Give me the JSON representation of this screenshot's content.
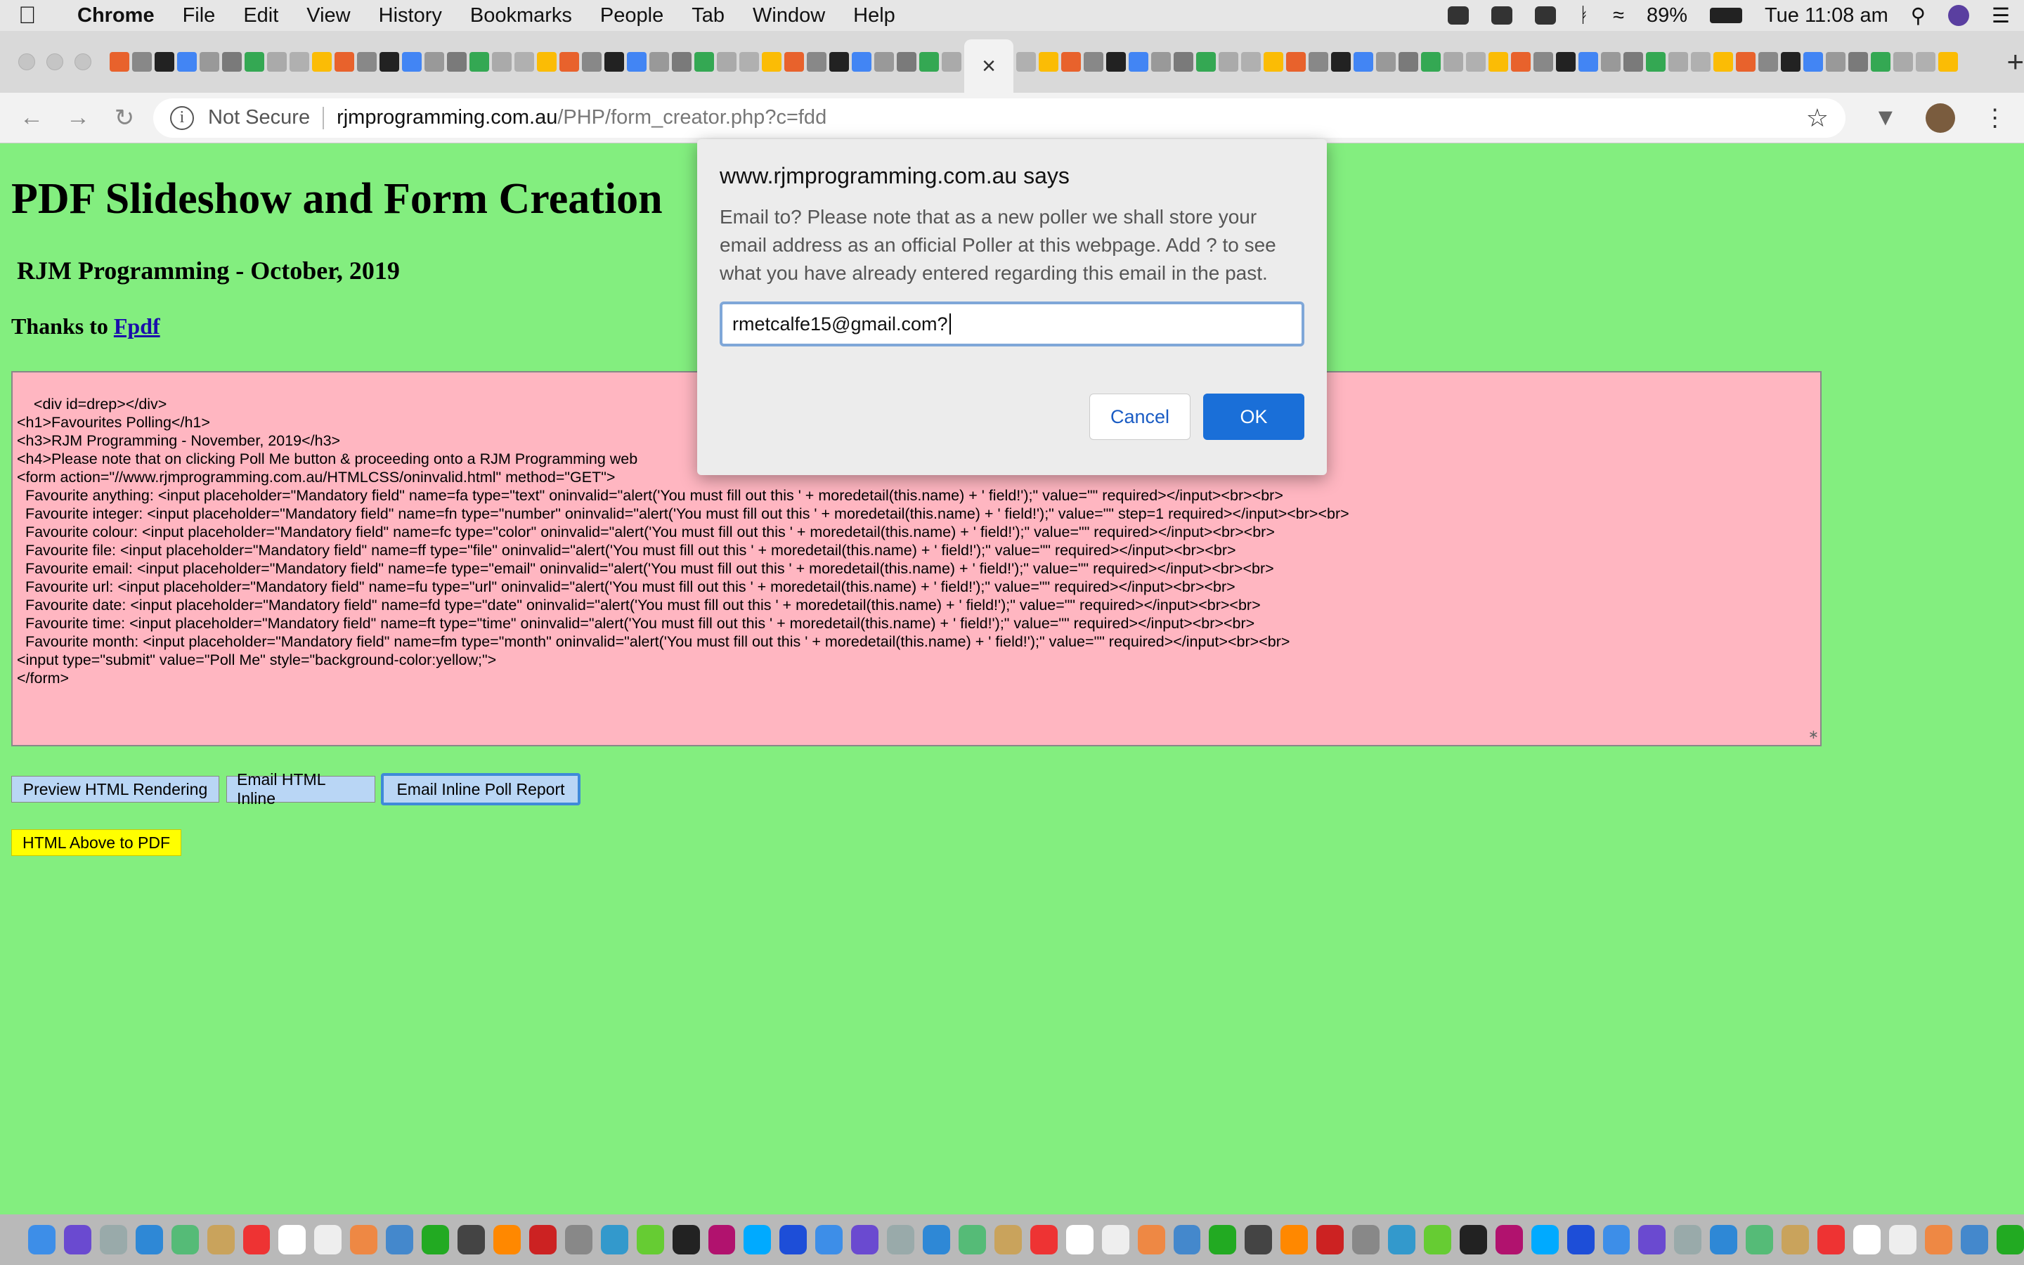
{
  "menubar": {
    "app": "Chrome",
    "items": [
      "File",
      "Edit",
      "View",
      "History",
      "Bookmarks",
      "People",
      "Tab",
      "Window",
      "Help"
    ],
    "battery": "89%",
    "clock": "Tue 11:08 am"
  },
  "tabstrip": {
    "close_glyph": "×",
    "newtab_glyph": "+"
  },
  "toolbar": {
    "security": "Not Secure",
    "url_host": "rjmprogramming.com.au",
    "url_path": "/PHP/form_creator.php?c=fdd"
  },
  "page": {
    "title": "PDF Slideshow and Form Creation",
    "subtitle": "RJM Programming - October, 2019",
    "thanks_prefix": "Thanks to ",
    "thanks_link": "Fpdf",
    "code_text": "<div id=drep></div>\n<h1>Favourites Polling</h1>\n<h3>RJM Programming - November, 2019</h3>\n<h4>Please note that on clicking Poll Me button & proceeding onto a RJM Programming web\n<form action=\"//www.rjmprogramming.com.au/HTMLCSS/oninvalid.html\" method=\"GET\">\n  Favourite anything: <input placeholder=\"Mandatory field\" name=fa type=\"text\" oninvalid=\"alert('You must fill out this ' + moredetail(this.name) + ' field!');\" value=\"\" required></input><br><br>\n  Favourite integer: <input placeholder=\"Mandatory field\" name=fn type=\"number\" oninvalid=\"alert('You must fill out this ' + moredetail(this.name) + ' field!');\" value=\"\" step=1 required></input><br><br>\n  Favourite colour: <input placeholder=\"Mandatory field\" name=fc type=\"color\" oninvalid=\"alert('You must fill out this ' + moredetail(this.name) + ' field!');\" value=\"\" required></input><br><br>\n  Favourite file: <input placeholder=\"Mandatory field\" name=ff type=\"file\" oninvalid=\"alert('You must fill out this ' + moredetail(this.name) + ' field!');\" value=\"\" required></input><br><br>\n  Favourite email: <input placeholder=\"Mandatory field\" name=fe type=\"email\" oninvalid=\"alert('You must fill out this ' + moredetail(this.name) + ' field!');\" value=\"\" required></input><br><br>\n  Favourite url: <input placeholder=\"Mandatory field\" name=fu type=\"url\" oninvalid=\"alert('You must fill out this ' + moredetail(this.name) + ' field!');\" value=\"\" required></input><br><br>\n  Favourite date: <input placeholder=\"Mandatory field\" name=fd type=\"date\" oninvalid=\"alert('You must fill out this ' + moredetail(this.name) + ' field!');\" value=\"\" required></input><br><br>\n  Favourite time: <input placeholder=\"Mandatory field\" name=ft type=\"time\" oninvalid=\"alert('You must fill out this ' + moredetail(this.name) + ' field!');\" value=\"\" required></input><br><br>\n  Favourite month: <input placeholder=\"Mandatory field\" name=fm type=\"month\" oninvalid=\"alert('You must fill out this ' + moredetail(this.name) + ' field!');\" value=\"\" required></input><br><br>\n<input type=\"submit\" value=\"Poll Me\" style=\"background-color:yellow;\">\n</form>",
    "buttons": {
      "preview": "Preview HTML Rendering",
      "email_inline": "Email HTML Inline",
      "email_poll": "Email Inline Poll Report",
      "to_pdf": "HTML Above to PDF"
    }
  },
  "dialog": {
    "title": "www.rjmprogramming.com.au says",
    "message": "Email to?  Please note that as a new poller we shall store your email address as an official Poller at this webpage.  Add ? to see what you have already entered regarding this email in the past.",
    "input_value": "rmetcalfe15@gmail.com?",
    "cancel": "Cancel",
    "ok": "OK"
  },
  "colors": {
    "page_bg": "#83ee7f",
    "code_bg": "#ffb6c1",
    "button_bg": "#b9d6f5",
    "pdf_button_bg": "#ffff00",
    "ok_button": "#1a6fd8"
  }
}
